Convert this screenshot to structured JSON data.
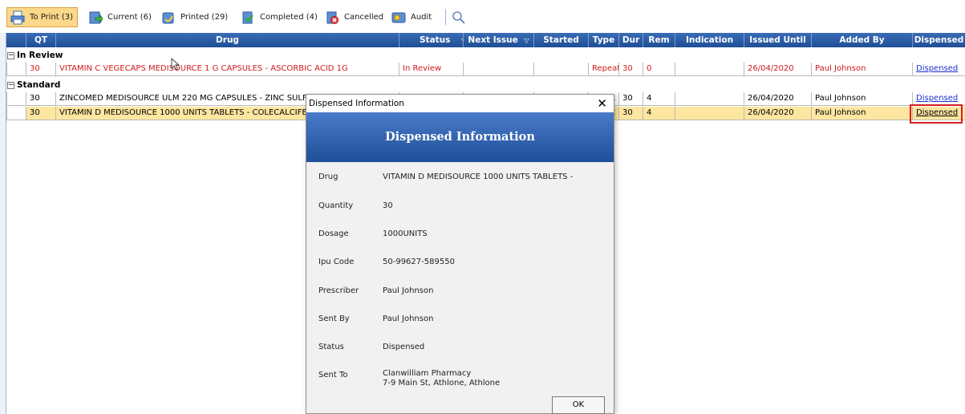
{
  "toolbar": {
    "tabs": [
      {
        "label": "To Print (3)",
        "icon": "printer-icon"
      },
      {
        "label": "Current (6)",
        "icon": "current-icon"
      },
      {
        "label": "Printed (29)",
        "icon": "printed-icon"
      },
      {
        "label": "Completed (4)",
        "icon": "completed-icon"
      },
      {
        "label": "Cancelled",
        "icon": "cancelled-icon"
      },
      {
        "label": "Audit",
        "icon": "audit-icon"
      }
    ],
    "search_icon": "search-icon"
  },
  "grid": {
    "headers": {
      "qt": "QT",
      "drug": "Drug",
      "status": "Status",
      "next_issue": "Next Issue",
      "started": "Started",
      "type": "Type",
      "dur": "Dur",
      "rem": "Rem",
      "indication": "Indication",
      "issued_until": "Issued Until",
      "added_by": "Added By",
      "dispensed": "Dispensed"
    },
    "filter_glyph": "▽",
    "groups": [
      {
        "label": "In Review",
        "rows": [
          {
            "qt": "30",
            "drug": "VITAMIN C VEGECAPS MEDISOURCE 1 G CAPSULES - ASCORBIC ACID 1G",
            "status": "In Review",
            "next_issue": "",
            "started": "",
            "type": "Repeat",
            "dur": "30",
            "rem": "0",
            "indication": "",
            "issued_until": "26/04/2020",
            "added_by": "Paul Johnson",
            "dispensed": "Dispensed"
          }
        ]
      },
      {
        "label": "Standard",
        "rows": [
          {
            "qt": "30",
            "drug": "ZINCOMED MEDISOURCE ULM 220 MG CAPSULES - ZINC SULFATE 220",
            "status": "",
            "next_issue": "",
            "started": "",
            "type": "t",
            "dur": "30",
            "rem": "4",
            "indication": "",
            "issued_until": "26/04/2020",
            "added_by": "Paul Johnson",
            "dispensed": "Dispensed"
          },
          {
            "qt": "30",
            "drug": "VITAMIN D MEDISOURCE 1000 UNITS TABLETS - COLECALCIFEROL 10",
            "status": "",
            "next_issue": "",
            "started": "",
            "type": "t",
            "dur": "30",
            "rem": "4",
            "indication": "",
            "issued_until": "26/04/2020",
            "added_by": "Paul Johnson",
            "dispensed": "Dispensed"
          }
        ]
      }
    ]
  },
  "dialog": {
    "title": "Dispensed Information",
    "close_glyph": "✕",
    "banner": "Dispensed Information",
    "fields": [
      {
        "label": "Drug",
        "value": "VITAMIN D MEDISOURCE 1000 UNITS TABLETS -"
      },
      {
        "label": "Quantity",
        "value": "30"
      },
      {
        "label": "Dosage",
        "value": "1000UNITS"
      },
      {
        "label": "Ipu Code",
        "value": "50-99627-589550"
      },
      {
        "label": "Prescriber",
        "value": "Paul Johnson"
      },
      {
        "label": "Sent By",
        "value": "Paul Johnson"
      },
      {
        "label": "Status",
        "value": "Dispensed"
      },
      {
        "label": "Sent To",
        "value": "Clanwilliam Pharmacy",
        "value2": "7-9 Main St, Athlone, Athlone"
      }
    ],
    "ok_label": "OK"
  },
  "colors": {
    "header_blue": "#2a5ba6",
    "selected_row": "#fde6a0",
    "review_red": "#d01b1b",
    "link_blue": "#1c2fd4",
    "highlight_red": "#d62020",
    "active_tab": "#fbd88a"
  }
}
